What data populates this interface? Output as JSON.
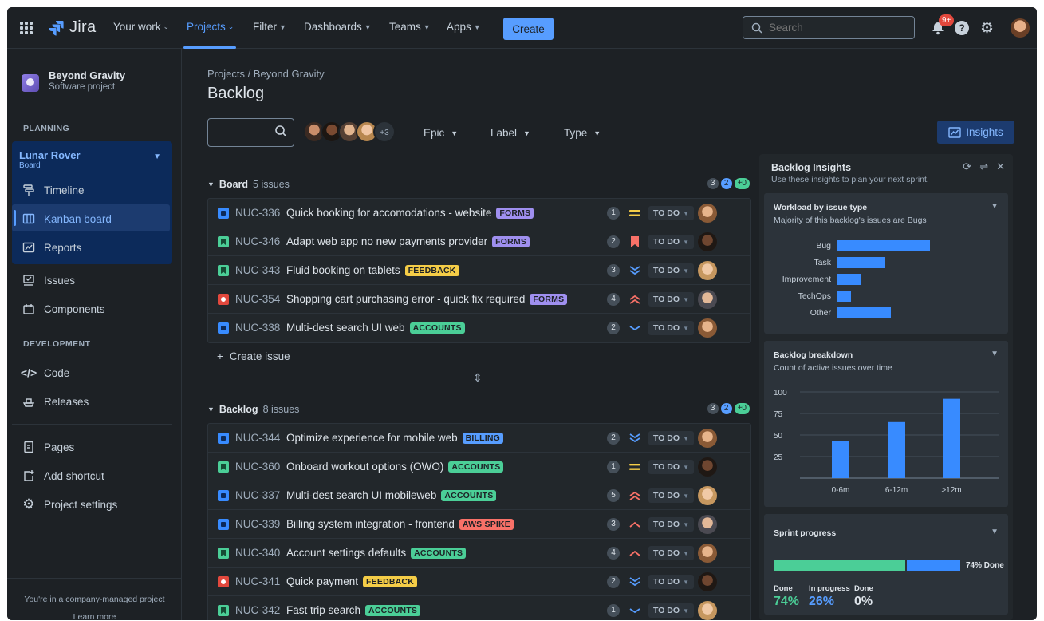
{
  "nav": {
    "logo": "Jira",
    "items": [
      {
        "label": "Your work"
      },
      {
        "label": "Projects"
      },
      {
        "label": "Filter"
      },
      {
        "label": "Dashboards"
      },
      {
        "label": "Teams"
      },
      {
        "label": "Apps"
      }
    ],
    "create_label": "Create",
    "search_placeholder": "Search",
    "notif_count": "9+"
  },
  "sidebar": {
    "project_name": "Beyond Gravity",
    "project_type": "Software project",
    "planning_label": "PLANNING",
    "board_name": "Lunar Rover",
    "board_sub": "Board",
    "timeline": "Timeline",
    "kanban": "Kanban board",
    "reports": "Reports",
    "issues": "Issues",
    "components": "Components",
    "development_label": "DEVELOPMENT",
    "code": "Code",
    "releases": "Releases",
    "pages": "Pages",
    "add_shortcut": "Add shortcut",
    "project_settings": "Project settings",
    "footer_text": "You're in a company-managed project",
    "footer_link": "Learn more"
  },
  "main": {
    "breadcrumb": "Projects  /  Beyond Gravity",
    "title": "Backlog",
    "avatars_more": "+3",
    "filters": {
      "epic": "Epic",
      "label": "Label",
      "type": "Type"
    },
    "insights_label": "Insights",
    "create_issue": "Create issue"
  },
  "board": {
    "name": "Board",
    "count": "5 issues",
    "pills": [
      "3",
      "2",
      "+0"
    ],
    "issues": [
      {
        "type": "task",
        "key": "NUC-336",
        "summary": "Quick booking for accomodations - website",
        "label": "FORMS",
        "label_class": "forms",
        "estimate": "1",
        "priority": "medium",
        "status": "TO DO"
      },
      {
        "type": "story",
        "key": "NUC-346",
        "summary": "Adapt web app no new payments provider",
        "label": "FORMS",
        "label_class": "forms",
        "estimate": "2",
        "priority": "highest",
        "status": "TO DO"
      },
      {
        "type": "story",
        "key": "NUC-343",
        "summary": "Fluid booking on tablets",
        "label": "FEEDBACK",
        "label_class": "feedback",
        "estimate": "3",
        "priority": "lowest",
        "status": "TO DO"
      },
      {
        "type": "bug",
        "key": "NUC-354",
        "summary": "Shopping cart purchasing error - quick fix required",
        "label": "FORMS",
        "label_class": "forms",
        "estimate": "4",
        "priority": "critical",
        "status": "TO DO"
      },
      {
        "type": "task",
        "key": "NUC-338",
        "summary": "Multi-dest search UI web",
        "label": "ACCOUNTS",
        "label_class": "accounts",
        "estimate": "2",
        "priority": "low",
        "status": "TO DO"
      }
    ]
  },
  "backlog": {
    "name": "Backlog",
    "count": "8 issues",
    "pills": [
      "3",
      "2",
      "+0"
    ],
    "issues": [
      {
        "type": "task",
        "key": "NUC-344",
        "summary": "Optimize experience for mobile web",
        "label": "BILLING",
        "label_class": "billing",
        "estimate": "2",
        "priority": "lowest",
        "status": "TO DO"
      },
      {
        "type": "story",
        "key": "NUC-360",
        "summary": "Onboard workout options (OWO)",
        "label": "ACCOUNTS",
        "label_class": "accounts",
        "estimate": "1",
        "priority": "medium",
        "status": "TO DO"
      },
      {
        "type": "task",
        "key": "NUC-337",
        "summary": "Multi-dest search UI mobileweb",
        "label": "ACCOUNTS",
        "label_class": "accounts",
        "estimate": "5",
        "priority": "critical",
        "status": "TO DO"
      },
      {
        "type": "task",
        "key": "NUC-339",
        "summary": "Billing system integration - frontend",
        "label": "AWS SPIKE",
        "label_class": "aws",
        "estimate": "3",
        "priority": "high",
        "status": "TO DO"
      },
      {
        "type": "story",
        "key": "NUC-340",
        "summary": "Account settings defaults",
        "label": "ACCOUNTS",
        "label_class": "accounts",
        "estimate": "4",
        "priority": "high",
        "status": "TO DO"
      },
      {
        "type": "bug",
        "key": "NUC-341",
        "summary": "Quick payment",
        "label": "FEEDBACK",
        "label_class": "feedback",
        "estimate": "2",
        "priority": "lowest",
        "status": "TO DO"
      },
      {
        "type": "story",
        "key": "NUC-342",
        "summary": "Fast trip search",
        "label": "ACCOUNTS",
        "label_class": "accounts",
        "estimate": "1",
        "priority": "low",
        "status": "TO DO"
      }
    ]
  },
  "insights": {
    "title": "Backlog Insights",
    "subtitle": "Use these insights to plan your next sprint.",
    "workload": {
      "title": "Workload by issue type",
      "subtitle": "Majority of this backlog's issues are Bugs"
    },
    "breakdown": {
      "title": "Backlog breakdown",
      "subtitle": "Count of active issues over time"
    },
    "sprint": {
      "title": "Sprint progress",
      "done_label": "74% Done",
      "stats": [
        {
          "label": "Done",
          "value": "74%",
          "color": "#4bce97"
        },
        {
          "label": "In progress",
          "value": "26%",
          "color": "#579dff"
        },
        {
          "label": "Done",
          "value": "0%",
          "color": "#dee4ea"
        }
      ]
    }
  },
  "chart_data": [
    {
      "type": "bar",
      "orientation": "horizontal",
      "categories": [
        "Bug",
        "Task",
        "Improvement",
        "TechOps",
        "Other"
      ],
      "values": [
        100,
        52,
        26,
        15,
        58
      ],
      "xlim": [
        0,
        100
      ]
    },
    {
      "type": "bar",
      "categories": [
        "0-6m",
        "6-12m",
        ">12m"
      ],
      "values": [
        43,
        65,
        92
      ],
      "ylim": [
        0,
        100
      ],
      "yticks": [
        100,
        75,
        50,
        25
      ],
      "grid": true
    }
  ],
  "colors": {
    "accent": "#579dff",
    "green": "#4bce97",
    "bar": "#388bff"
  }
}
